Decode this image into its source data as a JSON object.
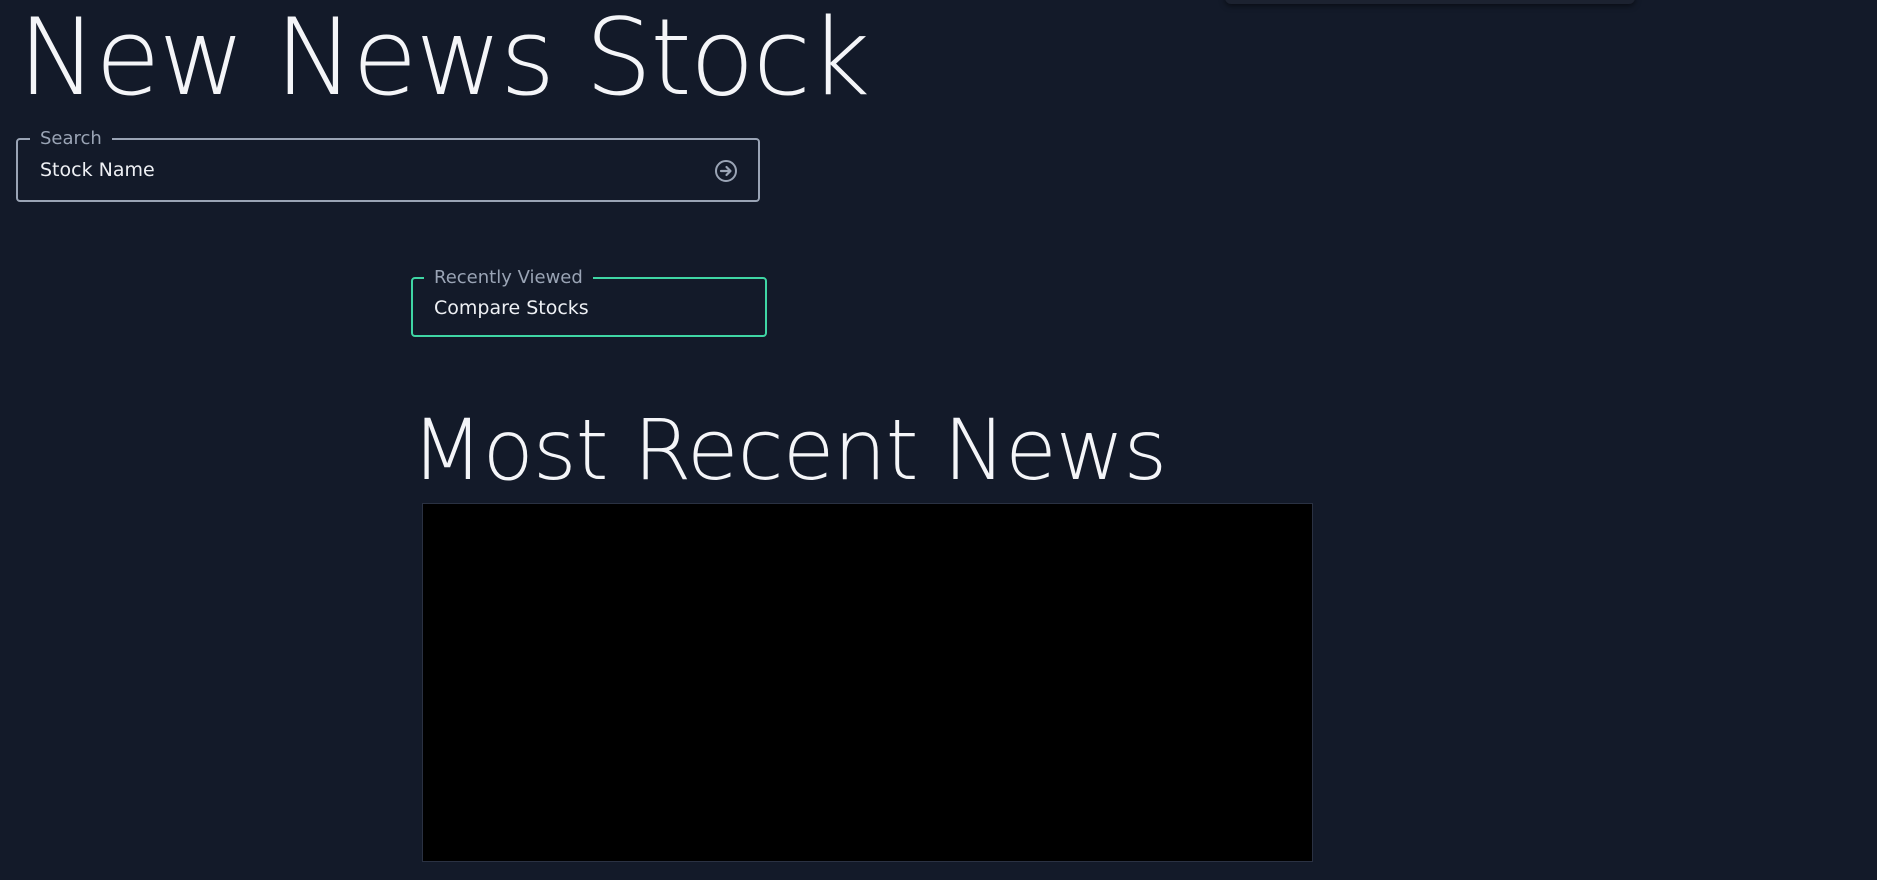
{
  "app": {
    "title": "New News Stock"
  },
  "search": {
    "legend": "Search",
    "placeholder": "Stock Name",
    "submit_icon": "arrow-circle-right-icon"
  },
  "recently_viewed": {
    "legend": "Recently Viewed",
    "value": "Compare Stocks"
  },
  "news": {
    "heading": "Most Recent News"
  },
  "colors": {
    "background": "#131a29",
    "text": "#eef0f4",
    "muted": "#9aa4b5",
    "accent": "#3fd6a4",
    "panel": "#000000"
  }
}
